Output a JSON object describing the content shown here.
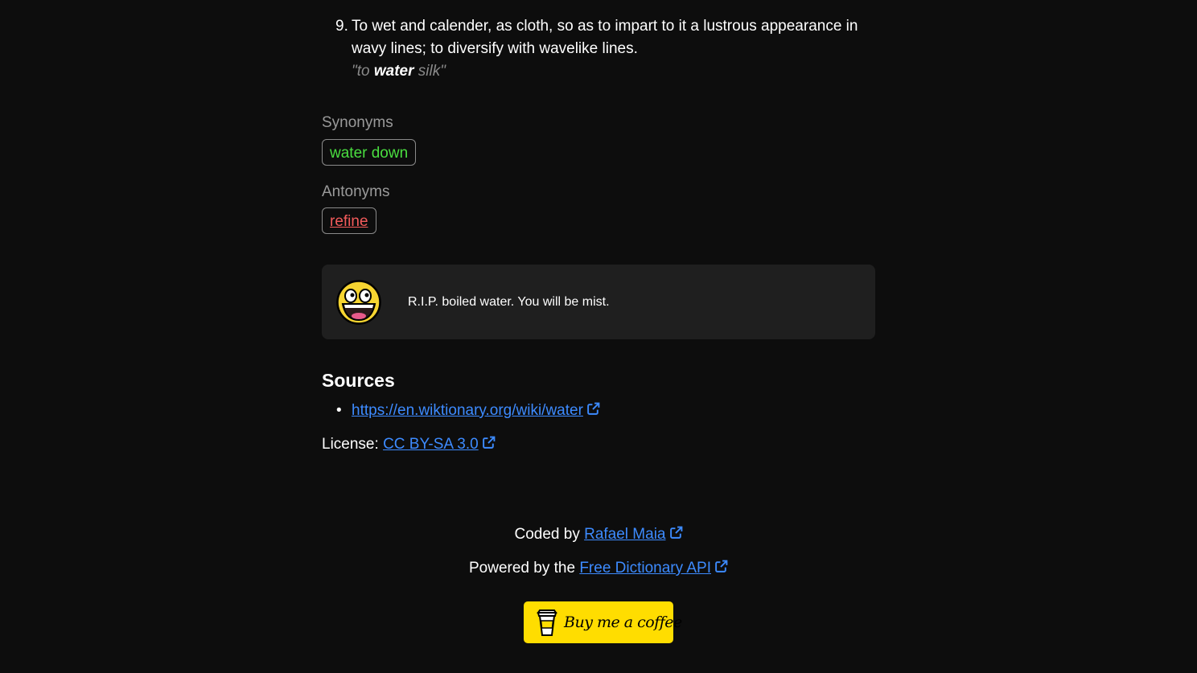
{
  "definition": {
    "number": "9.",
    "text": "To wet and calender, as cloth, so as to impart to it a lustrous appearance in wavy lines; to diversify with wavelike lines.",
    "example_prefix": "\"to ",
    "example_word": "water",
    "example_suffix": " silk\""
  },
  "synonyms": {
    "label": "Synonyms",
    "items": [
      "water down"
    ]
  },
  "antonyms": {
    "label": "Antonyms",
    "items": [
      "refine"
    ]
  },
  "joke": {
    "text": "R.I.P. boiled water. You will be mist.",
    "icon": "awesome-face-icon"
  },
  "sources": {
    "title": "Sources",
    "url": "https://en.wiktionary.org/wiki/water",
    "license_label": "License:",
    "license_name": "CC BY-SA 3.0"
  },
  "footer": {
    "coded_by_prefix": "Coded by",
    "author": "Rafael Maia",
    "powered_prefix": "Powered by the",
    "api_name": "Free Dictionary API",
    "coffee_label": "Buy me a coffee"
  },
  "colors": {
    "background": "#0d0d0d",
    "synonym": "#4ade40",
    "antonym": "#f45b5b",
    "link": "#3d8bff",
    "coffee_button": "#ffdd00",
    "card": "#1f1f1f"
  }
}
